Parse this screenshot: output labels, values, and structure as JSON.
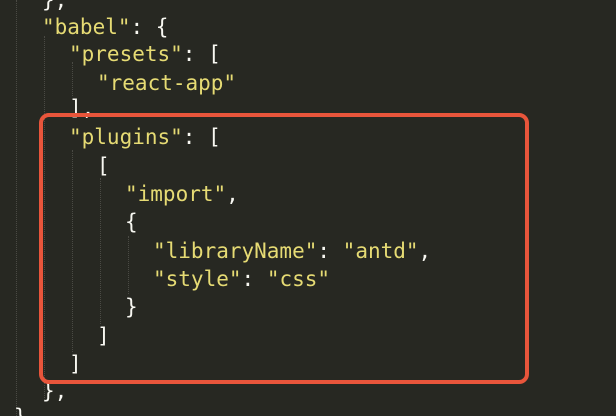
{
  "code_lines": [
    {
      "content": "},",
      "parts": [
        {
          "t": "},",
          "c": "punc"
        }
      ]
    },
    {
      "parts": [
        {
          "t": "\"babel\"",
          "c": "str"
        },
        {
          "t": ": {",
          "c": "punc"
        }
      ]
    },
    {
      "parts": [
        {
          "t": "\"presets\"",
          "c": "str"
        },
        {
          "t": ": [",
          "c": "punc"
        }
      ]
    },
    {
      "parts": [
        {
          "t": "\"react-app\"",
          "c": "str"
        }
      ]
    },
    {
      "parts": [
        {
          "t": "],",
          "c": "punc"
        }
      ]
    },
    {
      "parts": [
        {
          "t": "\"plugins\"",
          "c": "str"
        },
        {
          "t": ": [",
          "c": "punc"
        }
      ]
    },
    {
      "parts": [
        {
          "t": "[",
          "c": "punc"
        }
      ]
    },
    {
      "parts": [
        {
          "t": "\"import\"",
          "c": "str"
        },
        {
          "t": ",",
          "c": "punc"
        }
      ]
    },
    {
      "parts": [
        {
          "t": "{",
          "c": "punc"
        }
      ]
    },
    {
      "parts": [
        {
          "t": "\"libraryName\"",
          "c": "str"
        },
        {
          "t": ": ",
          "c": "punc"
        },
        {
          "t": "\"antd\"",
          "c": "str"
        },
        {
          "t": ",",
          "c": "punc"
        }
      ]
    },
    {
      "parts": [
        {
          "t": "\"style\"",
          "c": "str"
        },
        {
          "t": ": ",
          "c": "punc"
        },
        {
          "t": "\"css\"",
          "c": "str"
        }
      ]
    },
    {
      "parts": [
        {
          "t": "}",
          "c": "punc"
        }
      ]
    },
    {
      "parts": [
        {
          "t": "]",
          "c": "punc"
        }
      ]
    },
    {
      "parts": [
        {
          "t": "]",
          "c": "punc"
        }
      ]
    },
    {
      "parts": [
        {
          "t": "},",
          "c": "punc"
        }
      ]
    },
    {
      "parts": [
        {
          "t": "}",
          "c": "punc"
        }
      ]
    }
  ],
  "colors": {
    "background": "#272822",
    "string": "#e6db74",
    "punctuation": "#f8f8f2",
    "highlight_border": "#e8553b"
  }
}
